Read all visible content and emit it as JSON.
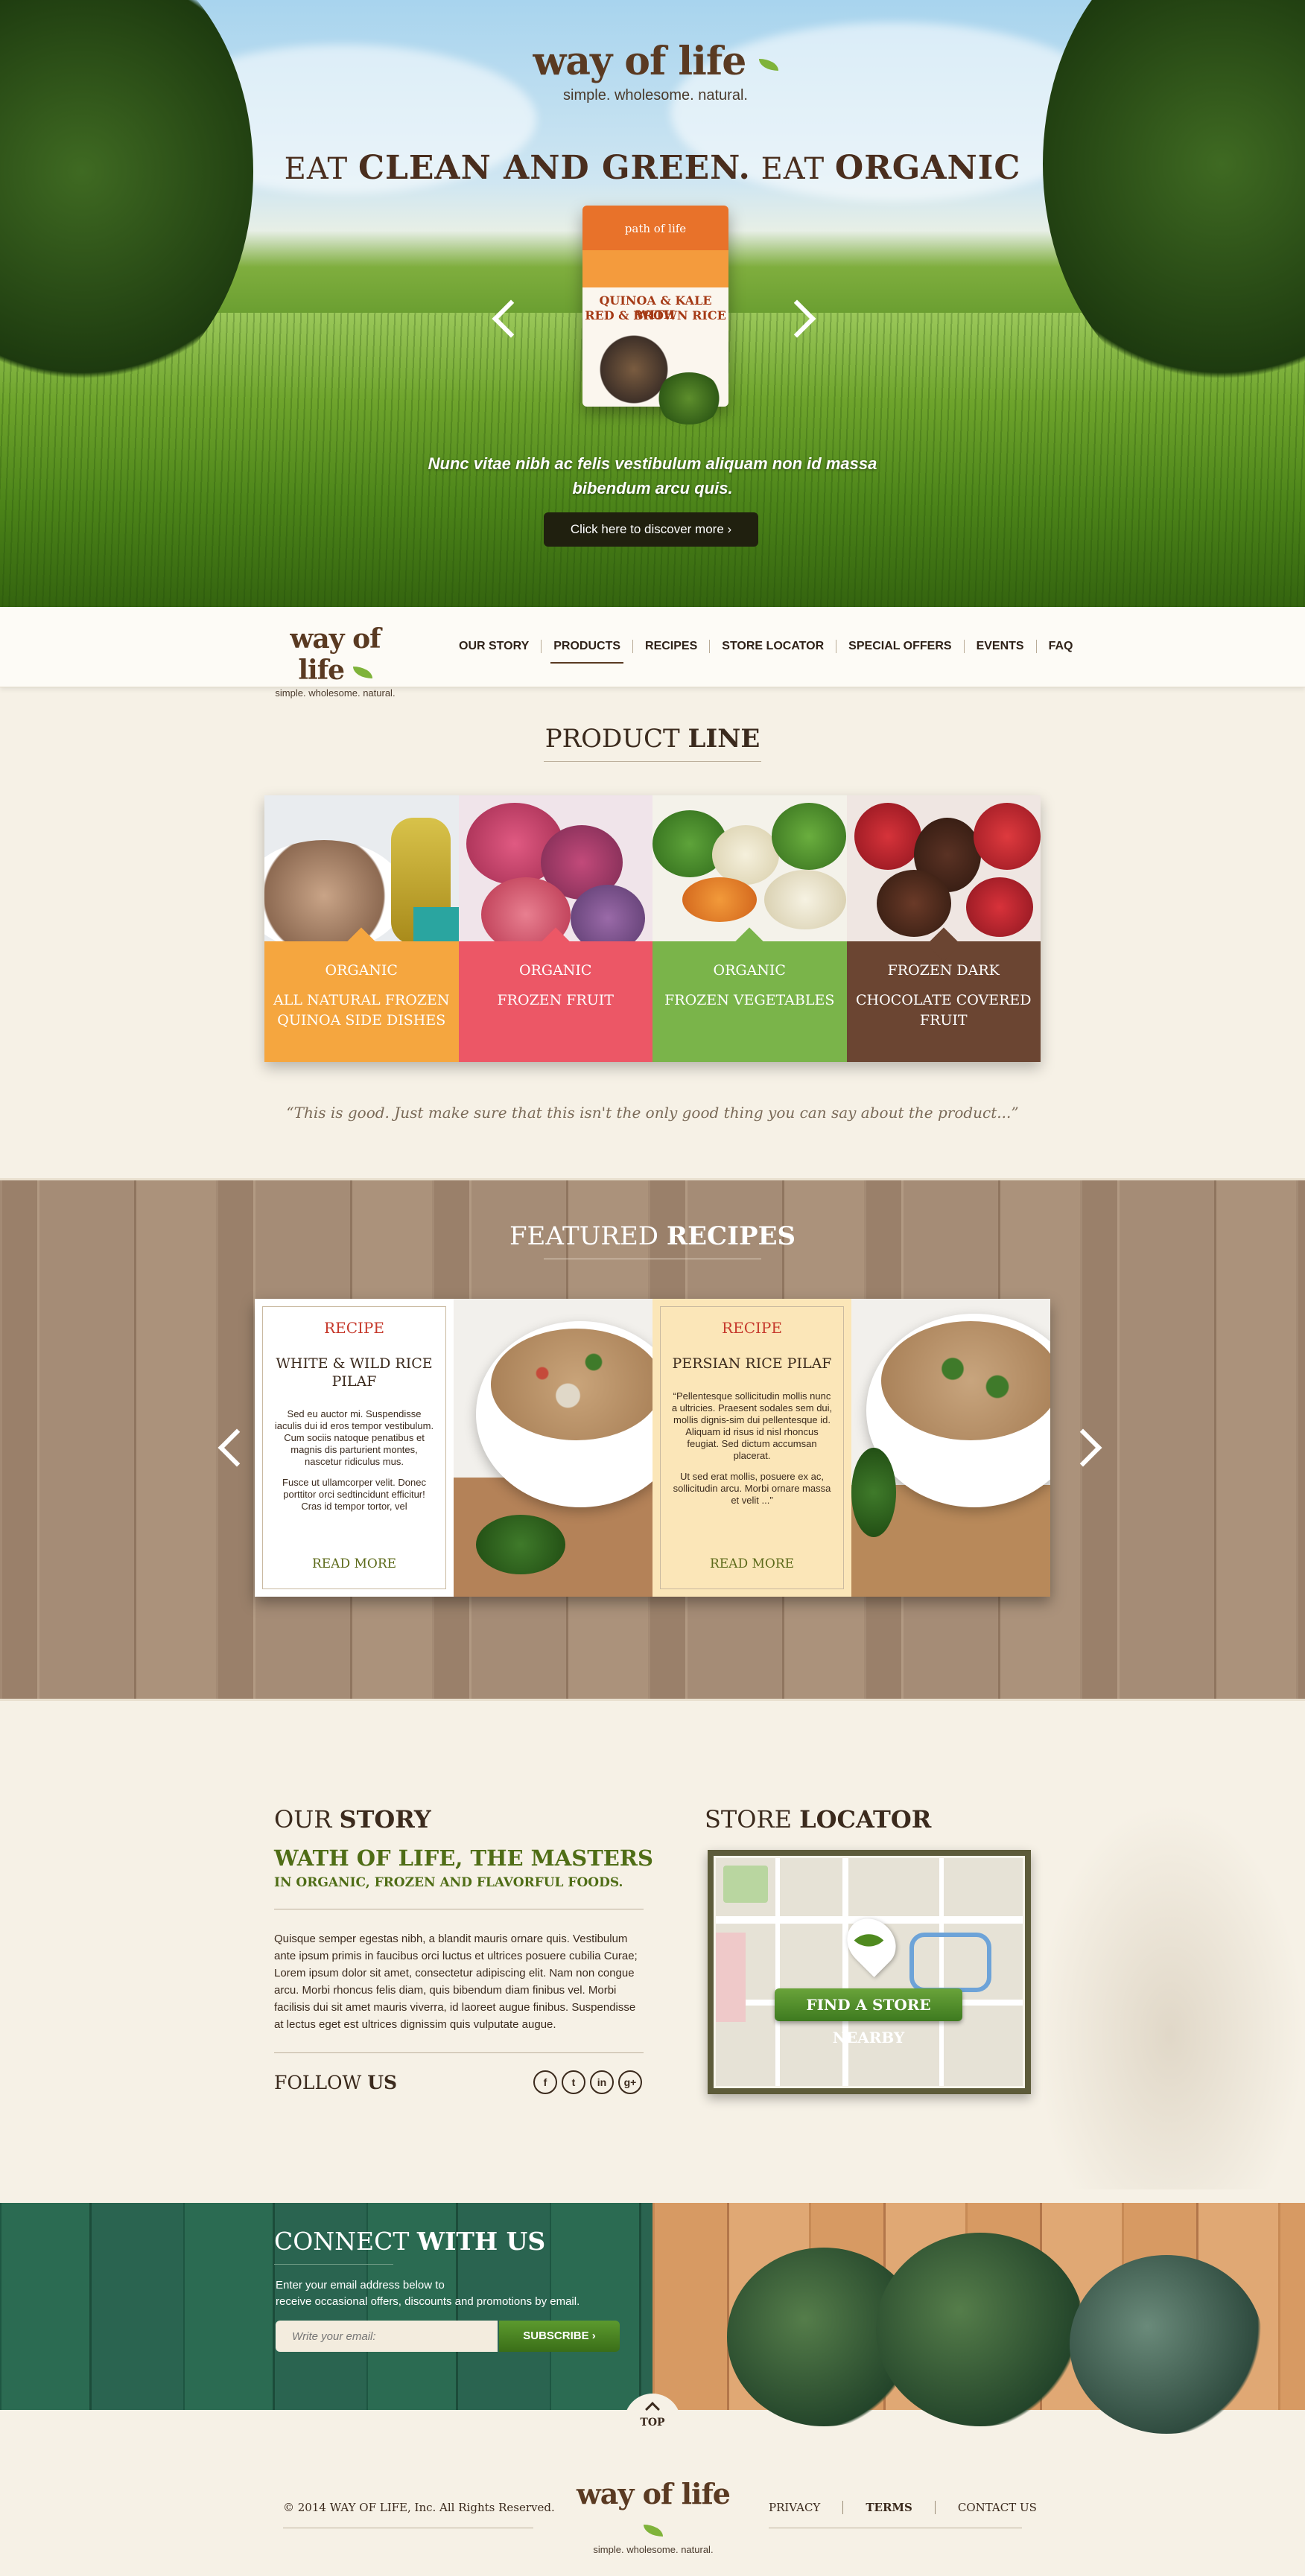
{
  "hero": {
    "logo_word": "way of life",
    "tagline": "simple. wholesome. natural.",
    "title_parts": [
      "EAT",
      "CLEAN AND GREEN.",
      "EAT",
      "ORGANIC"
    ],
    "product": {
      "brand": "path of life",
      "name_line1": "QUINOA & KALE WITH",
      "name_line2": "RED & BROWN RICE"
    },
    "text": "Nunc vitae nibh ac felis vestibulum aliquam non id massa bibendum arcu quis.",
    "cta": "Click here to discover more  ›"
  },
  "nav": {
    "logo_word": "way of life",
    "tagline": "simple. wholesome. natural.",
    "items": [
      "OUR STORY",
      "PRODUCTS",
      "RECIPES",
      "STORE LOCATOR",
      "SPECIAL OFFERS",
      "EVENTS",
      "FAQ"
    ],
    "active": "PRODUCTS"
  },
  "product_line": {
    "title_light": "PRODUCT",
    "title_bold": "LINE",
    "items": [
      {
        "label1": "ORGANIC",
        "label2": "ALL NATURAL FROZEN QUINOA SIDE DISHES",
        "color": "#f5a63f"
      },
      {
        "label1": "ORGANIC",
        "label2": "FROZEN FRUIT",
        "color": "#ec5766"
      },
      {
        "label1": "ORGANIC",
        "label2": "FROZEN VEGETABLES",
        "color": "#7ab44a"
      },
      {
        "label1": "FROZEN DARK",
        "label2": "CHOCOLATE COVERED FRUIT",
        "color": "#6b4532"
      }
    ],
    "quote": "“This is good. Just make sure that this isn't the only good thing you can say about the product...”"
  },
  "featured": {
    "title_light": "FEATURED",
    "title_bold": "RECIPES",
    "recipes": [
      {
        "tag": "RECIPE",
        "title": "WHITE & WILD RICE PILAF",
        "desc": "Sed eu auctor mi. Suspendisse iaculis dui id eros tempor vestibulum. Cum sociis natoque penatibus et magnis dis parturient montes, nascetur ridiculus mus.",
        "desc2": "Fusce ut ullamcorper velit. Donec porttitor orci sedtincidunt efficitur! Cras id tempor tortor, vel",
        "more": "READ MORE",
        "bg": "#ffffff"
      },
      {
        "tag": "RECIPE",
        "title": "PERSIAN RICE PILAF",
        "desc": "“Pellentesque sollicitudin mollis nunc a ultricies. Praesent sodales sem dui, mollis dignis-sim dui pellentesque id. Aliquam id risus id nisl rhoncus feugiat. Sed dictum accumsan placerat.",
        "desc2": "Ut sed erat mollis, posuere ex ac, sollicitudin arcu. Morbi ornare massa et velit ...”",
        "more": "READ MORE",
        "bg": "#fbe6b8"
      }
    ]
  },
  "story": {
    "title_light": "OUR",
    "title_bold": "STORY",
    "subtitle": "WATH OF LIFE, THE MASTERS",
    "subtitle2": "IN ORGANIC, FROZEN AND FLAVORFUL FOODS.",
    "body": "Quisque semper egestas nibh, a blandit mauris ornare quis. Vestibulum ante ipsum primis in faucibus orci luctus et ultrices posuere cubilia Curae; Lorem ipsum dolor sit amet, consectetur adipiscing elit. Nam non congue arcu. Morbi rhoncus felis diam, quis bibendum diam finibus vel. Morbi facilisis dui sit amet mauris viverra, id laoreet augue finibus. Suspendisse at lectus eget est ultrices dignissim quis vulputate augue.",
    "follow_light": "FOLLOW",
    "follow_bold": "US",
    "social": [
      {
        "icon": "facebook-icon",
        "glyph": "f"
      },
      {
        "icon": "twitter-icon",
        "glyph": "t"
      },
      {
        "icon": "linkedin-icon",
        "glyph": "in"
      },
      {
        "icon": "google-plus-icon",
        "glyph": "g+"
      }
    ]
  },
  "store_locator": {
    "title_light": "STORE",
    "title_bold": "LOCATOR",
    "button": "FIND A STORE NEARBY"
  },
  "connect": {
    "title_light": "CONNECT",
    "title_bold": "WITH US",
    "text1": "Enter your email address below to",
    "text2": "receive occasional offers, discounts and promotions by email.",
    "placeholder": "Write your email:",
    "button": "SUBSCRIBE  ›"
  },
  "top_button": "TOP",
  "footer": {
    "copyright": "© 2014 WAY OF LIFE, Inc. All Rights Reserved.",
    "logo_word": "way of life",
    "tagline": "simple. wholesome. natural.",
    "links": [
      "PRIVACY",
      "TERMS",
      "CONTACT US"
    ]
  }
}
